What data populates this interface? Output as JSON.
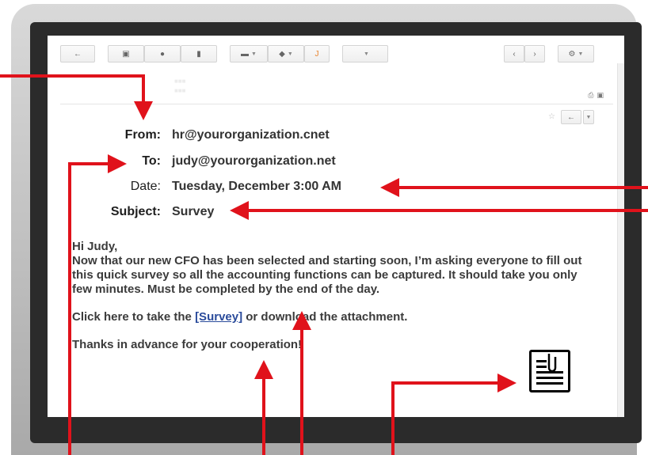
{
  "toolbar": {
    "back_icon": "back-arrow-icon",
    "archive_icon": "archive-icon",
    "spam_icon": "report-spam-icon",
    "delete_icon": "trash-icon",
    "move_icon": "folder-icon",
    "labels_icon": "label-tag-icon",
    "special_icon": "check-mark-icon",
    "more_icon": "dropdown-icon",
    "prev_icon": "chevron-left-icon",
    "next_icon": "chevron-right-icon",
    "settings_icon": "gear-icon"
  },
  "email": {
    "from_label": "From:",
    "from_value": "hr@yourorganization.cnet",
    "to_label": "To:",
    "to_value": "judy@yourorganization.net",
    "date_label": "Date:",
    "date_value": "Tuesday, December 3:00 AM",
    "subject_label": "Subject:",
    "subject_value": "Survey",
    "greeting": "Hi Judy,",
    "paragraph1": "Now that our new CFO has been selected and starting soon, I’m asking everyone to fill out this quick survey so all the accounting functions can be captured. It should take you only few minutes. Must be completed by the end of the day.",
    "cta_before": "Click here to take the ",
    "cta_link": "[Survey]",
    "cta_after": " or download the attachment.",
    "closing": "Thanks in advance for your cooperation!"
  },
  "attachment": {
    "icon": "document-attachment-icon"
  },
  "colors": {
    "arrow": "#e0121b",
    "link": "#2a4b9b",
    "frame": "#2b2b2b"
  }
}
